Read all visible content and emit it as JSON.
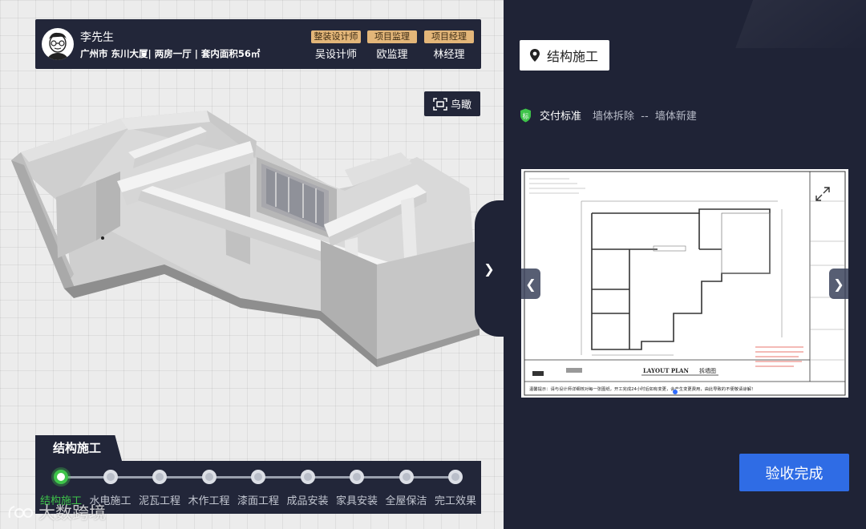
{
  "client": {
    "name": "李先生",
    "info": "广州市 东川大厦| 两房一厅 | 套内面积56㎡"
  },
  "staff": [
    {
      "role": "整装设计师",
      "person": "吴设计师"
    },
    {
      "role": "项目监理",
      "person": "欧监理"
    },
    {
      "role": "项目经理",
      "person": "林经理"
    }
  ],
  "toolbar": {
    "aerial_label": "鸟瞰"
  },
  "stage_panel": {
    "title": "结构施工",
    "active_index": 0,
    "stages": [
      "结构施工",
      "水电施工",
      "泥瓦工程",
      "木作工程",
      "漆面工程",
      "成品安装",
      "家具安装",
      "全屋保洁",
      "完工效果"
    ]
  },
  "watermark": {
    "text": "大数跨境"
  },
  "panel": {
    "phase": "结构施工",
    "standard_badge": "标",
    "standard_title": "交付标准",
    "standard_steps": "墙体拆除  --  墙体新建"
  },
  "drawing": {
    "plan_title": "LAYOUT   PLAN",
    "plan_subtitle": "拆墙图",
    "note": "温馨提示：请与设计师详细核对每一张图纸，开工完成24小时后如有变更，会产生变更费用，由此导致的不便敬请谅解！"
  },
  "actions": {
    "accept_label": "验收完成"
  },
  "colors": {
    "dark_panel": "#1f2336",
    "accent_green": "#3ec44a",
    "accent_blue": "#2f6ce5",
    "role_tag": "#e3b679"
  }
}
